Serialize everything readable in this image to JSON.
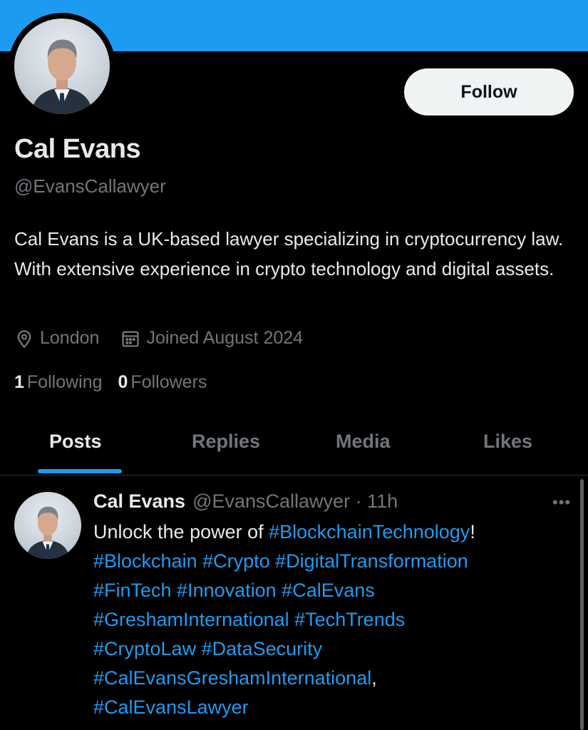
{
  "profile": {
    "name": "Cal Evans",
    "handle": "@EvansCallawyer",
    "follow_label": "Follow",
    "bio": "Cal Evans is a UK-based lawyer specializing in cryptocurrency law. With extensive experience in crypto technology and digital assets.",
    "location": "London",
    "location_icon": "location-pin-icon",
    "joined": "Joined August 2024",
    "joined_icon": "calendar-icon",
    "following_count": "1",
    "following_label": "Following",
    "followers_count": "0",
    "followers_label": "Followers"
  },
  "tabs": [
    {
      "label": "Posts",
      "active": true
    },
    {
      "label": "Replies",
      "active": false
    },
    {
      "label": "Media",
      "active": false
    },
    {
      "label": "Likes",
      "active": false
    }
  ],
  "post": {
    "name": "Cal Evans",
    "handle_time": "@EvansCallawyer · 11h",
    "more_label": "•••",
    "line1_text": "Unlock the power of ",
    "line1_tag": "#BlockchainTechnology",
    "line1_end": "!",
    "line2": "#Blockchain #Crypto #DigitalTransformation",
    "line3": "#FinTech #Innovation #CalEvans",
    "line4": "#GreshamInternational #TechTrends",
    "line5": "#CryptoLaw #DataSecurity",
    "line6_tag": "#CalEvansGreshamInternational",
    "line6_end": ",",
    "line7": "#CalEvansLawyer"
  },
  "colors": {
    "accent": "#1d9bf0",
    "background": "#000000",
    "text": "#e7e9ea",
    "muted": "#71767b"
  }
}
